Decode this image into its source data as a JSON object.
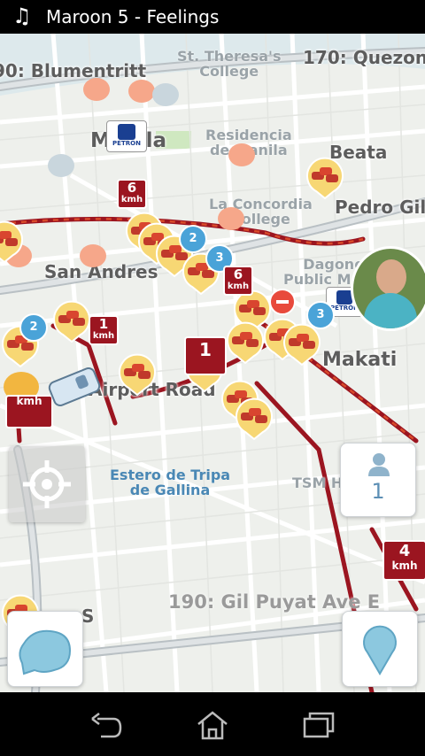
{
  "status_bar": {
    "music_icon": "music-note-icon",
    "now_playing": "Maroon 5 - Feelings"
  },
  "map": {
    "labels": {
      "blumentritt": "90: Blumentritt",
      "st_theresas": "St. Theresa's\nCollege",
      "quezon": "170: Quezon",
      "manila": "Manila",
      "residencia": "Residencia\nde Manila",
      "beata": "Beata",
      "la_concordia": "La Concordia\nCollege",
      "pedro_gil": "Pedro Gil",
      "san_andres": "San Andres",
      "dagonoy": "Dagonoy\nPublic Market",
      "makati": "Makati",
      "airport": "Airport Road",
      "estero": "Estero de Tripa\nde Gallina",
      "tsm": "TSM House",
      "gil_puyat": "190: Gil Puyat Ave E",
      "partial_s": "S"
    },
    "badges": [
      "2",
      "3",
      "3",
      "2"
    ],
    "speed_signs": [
      {
        "num": "6",
        "unit": "kmh"
      },
      {
        "num": "6",
        "unit": "kmh"
      },
      {
        "num": "1",
        "unit": "kmh"
      },
      {
        "num": "1",
        "unit": "kmh"
      },
      {
        "num": "",
        "unit": "kmh"
      },
      {
        "num": "4",
        "unit": "kmh"
      }
    ],
    "gas_brand": "PETRON"
  },
  "controls": {
    "me_on_map_count": "1",
    "recenter_icon": "crosshair-icon",
    "menu_icon": "waze-menu-icon",
    "report_icon": "report-pin-icon"
  },
  "nav_bar": {
    "back_icon": "back-icon",
    "home_icon": "home-icon",
    "recents_icon": "recent-apps-icon"
  },
  "colors": {
    "traffic_red": "#9b1520",
    "map_bg": "#eef0ec",
    "badge_blue": "#4aa3d8",
    "pin_yellow": "#f7d774"
  }
}
